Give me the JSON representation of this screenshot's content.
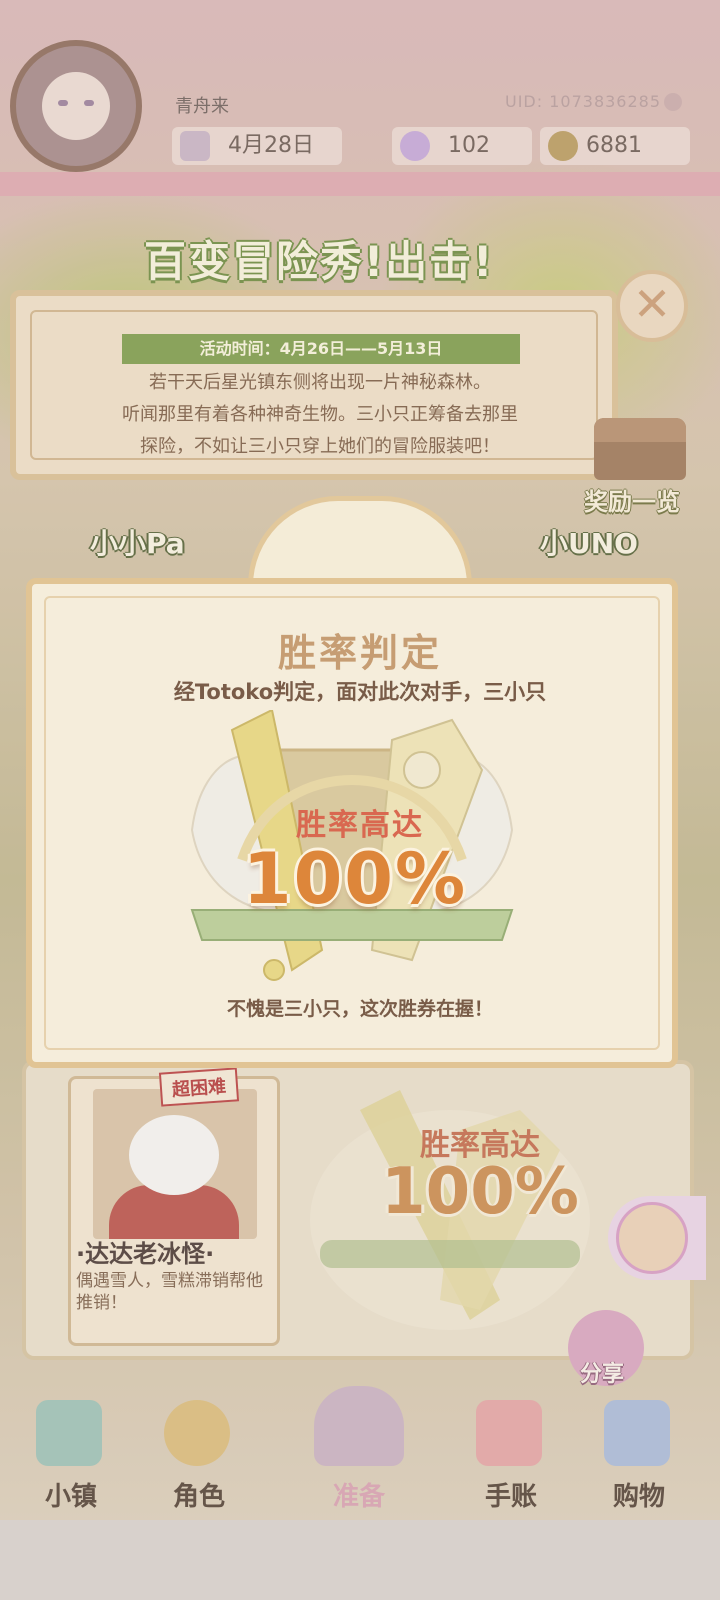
{
  "header": {
    "username": "青舟来",
    "uid": "UID: 1073836285",
    "date": "4月28日",
    "gems": "102",
    "coins": "6881"
  },
  "event": {
    "title": "百变冒险秀!出击!",
    "activity_time": "活动时间：4月26日——5月13日",
    "description": [
      "若干天后星光镇东侧将出现一片神秘森林。",
      "听闻那里有着各种神奇生物。三小只正筹备去那里",
      "探险，不如让三小只穿上她们的冒险服装吧！"
    ],
    "reward_label": "奖励一览",
    "left_team_partial": "小小Pa",
    "right_team_partial": "小UNO"
  },
  "opponent": {
    "stamp": "超困难",
    "name": "·达达老冰怪·",
    "description": "偶遇雪人，雪糕滞销帮他推销！"
  },
  "dialog": {
    "title": "胜率判定",
    "subtitle": "经Totoko判定，面对此次对手，三小只",
    "win_rate_label": "胜率高达",
    "win_rate_value": "100%",
    "footer": "不愧是三小只，这次胜券在握！"
  },
  "background_result": {
    "win_rate_label": "胜率高达",
    "win_rate_value": "100%"
  },
  "share": {
    "label": "分享"
  },
  "nav": [
    {
      "label": "小镇",
      "icon": "map-icon"
    },
    {
      "label": "角色",
      "icon": "character-icon"
    },
    {
      "label": "准备",
      "icon": "wardrobe-icon"
    },
    {
      "label": "手账",
      "icon": "journal-icon"
    },
    {
      "label": "购物",
      "icon": "shopping-bag-icon"
    }
  ],
  "colors": {
    "accent_green": "#7e9b4c",
    "gold_border": "#e1c18b",
    "win_orange": "#dc7a25"
  }
}
